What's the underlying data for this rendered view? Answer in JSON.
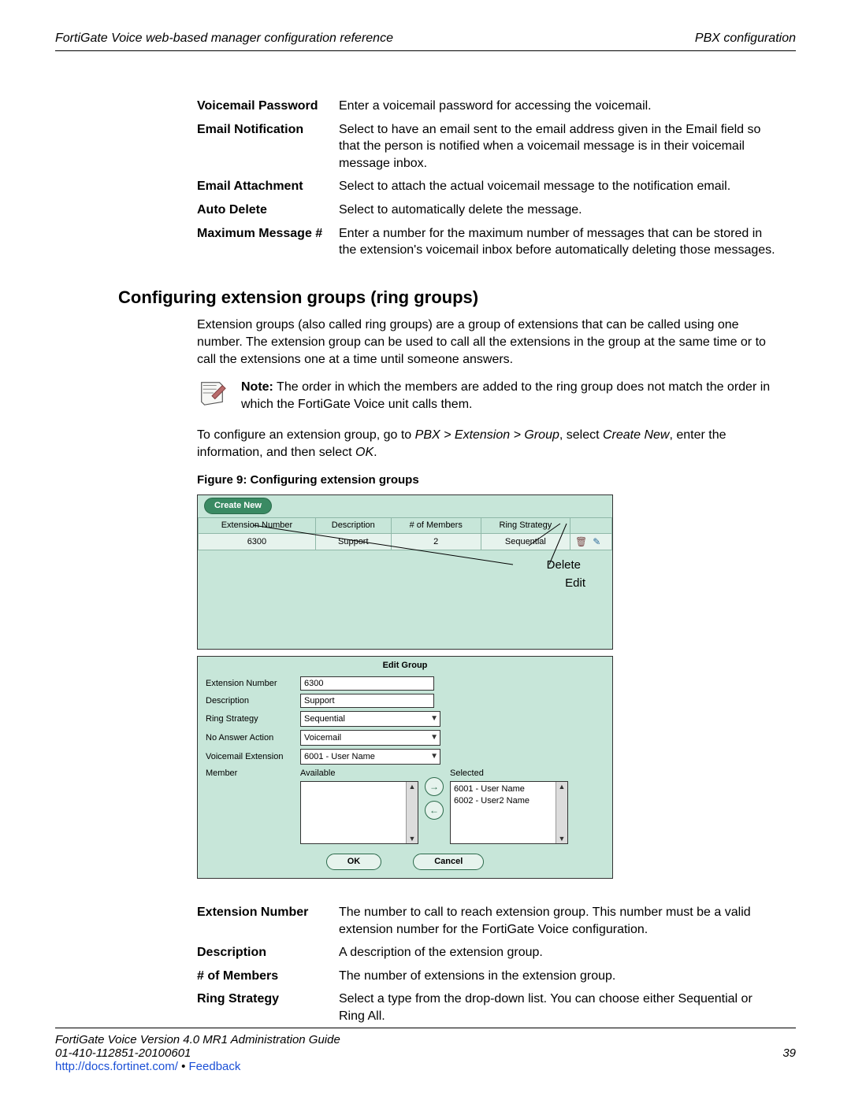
{
  "header": {
    "left": "FortiGate Voice web-based manager configuration reference",
    "right": "PBX configuration"
  },
  "def_table_top": [
    {
      "term": "Voicemail Password",
      "desc": "Enter a voicemail password for accessing the voicemail."
    },
    {
      "term": "Email Notification",
      "desc": "Select to have an email sent to the email address given in the Email field so that the person is notified when a voicemail message is in their voicemail message inbox."
    },
    {
      "term": "Email Attachment",
      "desc": "Select to attach the actual voicemail message to the notification email."
    },
    {
      "term": "Auto Delete",
      "desc": "Select to automatically delete the message."
    },
    {
      "term": "Maximum Message #",
      "desc": "Enter a number for the maximum number of messages that can be stored in the extension's voicemail inbox before automatically deleting those messages."
    }
  ],
  "section_heading": "Configuring extension groups (ring groups)",
  "para1": "Extension groups (also called ring groups) are a group of extensions that can be called using one number. The extension group can be used to call all the extensions in the group at the same time or to call the extensions one at a time until someone answers.",
  "note": {
    "lead": "Note:",
    "text": " The order in which the members are added to the ring group does not match the order in which the FortiGate Voice unit calls them."
  },
  "para2_pre": "To configure an extension group, go to ",
  "para2_path": "PBX > Extension > Group",
  "para2_mid1": ", select ",
  "para2_em2": "Create New",
  "para2_mid2": ", enter the information, and then select ",
  "para2_em3": "OK",
  "para2_end": ".",
  "figure_caption": "Figure 9: Configuring extension groups",
  "figure9": {
    "create_new": "Create New",
    "columns": [
      "Extension Number",
      "Description",
      "# of Members",
      "Ring Strategy",
      ""
    ],
    "row": {
      "ext": "6300",
      "desc": "Support",
      "members": "2",
      "strategy": "Sequential"
    },
    "delete_label": "Delete",
    "edit_label": "Edit",
    "edit_title": "Edit Group",
    "form": {
      "ext_label": "Extension Number",
      "ext_val": "6300",
      "desc_label": "Description",
      "desc_val": "Support",
      "strategy_label": "Ring Strategy",
      "strategy_val": "Sequential",
      "noanswer_label": "No Answer Action",
      "noanswer_val": "Voicemail",
      "vmext_label": "Voicemail Extension",
      "vmext_val": "6001 - User Name",
      "member_label": "Member",
      "available_label": "Available",
      "selected_label": "Selected",
      "selected_items": [
        "6001 - User Name",
        "6002 - User2 Name"
      ],
      "ok": "OK",
      "cancel": "Cancel"
    }
  },
  "def_table_bottom": [
    {
      "term": "Extension Number",
      "desc": "The number to call to reach extension group. This number must be a valid extension number for the FortiGate Voice configuration."
    },
    {
      "term": "Description",
      "desc": "A description of the extension group."
    },
    {
      "term": "# of Members",
      "desc": "The number of extensions in the extension group."
    },
    {
      "term": "Ring Strategy",
      "desc": "Select a type from the drop-down list. You can choose either Sequential or Ring All."
    }
  ],
  "footer": {
    "line1": "FortiGate Voice Version 4.0 MR1 Administration Guide",
    "line2": "01-410-112851-20100601",
    "pagenum": "39",
    "link": "http://docs.fortinet.com/",
    "feedback": "Feedback"
  }
}
